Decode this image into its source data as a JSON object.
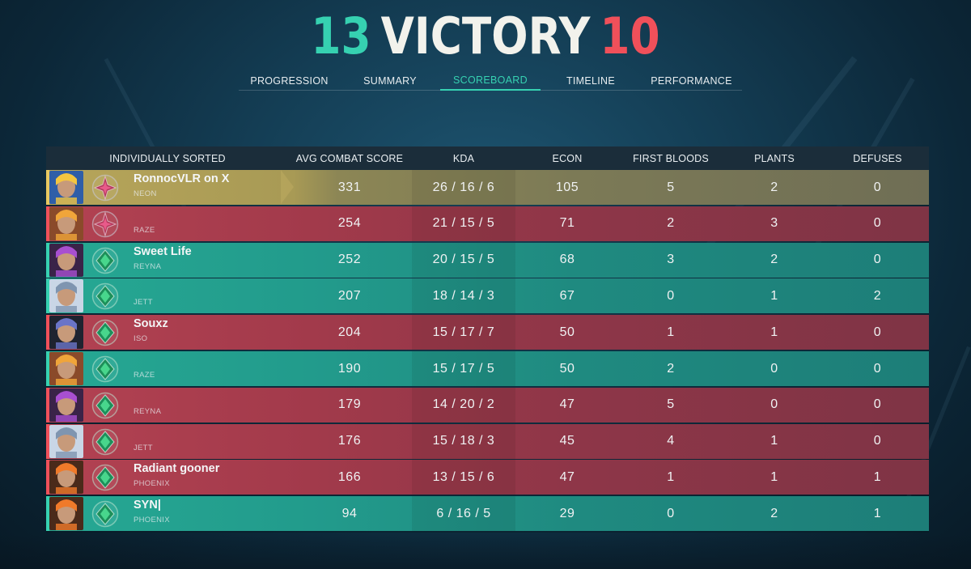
{
  "score": {
    "ally": "13",
    "result": "VICTORY",
    "enemy": "10"
  },
  "tabs": [
    {
      "label": "PROGRESSION"
    },
    {
      "label": "SUMMARY"
    },
    {
      "label": "SCOREBOARD",
      "active": true
    },
    {
      "label": "TIMELINE"
    },
    {
      "label": "PERFORMANCE"
    }
  ],
  "columns": {
    "name": "INDIVIDUALLY SORTED",
    "acs": "AVG COMBAT SCORE",
    "kda": "KDA",
    "econ": "ECON",
    "first_bloods": "FIRST BLOODS",
    "plants": "PLANTS",
    "defuses": "DEFUSES"
  },
  "colors": {
    "ally": "#36d1b1",
    "enemy": "#f0505a",
    "self_row": "#a0944e",
    "ally_row": "#229b8c",
    "enemy_row": "#9e3a4a"
  },
  "players": [
    {
      "name": "RonnocVLR on X",
      "agent": "NEON",
      "team": "self",
      "rank_icon": "ascendant-rank-icon",
      "acs": "331",
      "kda": "26 / 16 / 6",
      "econ": "105",
      "first_bloods": "5",
      "plants": "2",
      "defuses": "0"
    },
    {
      "name": "",
      "agent": "RAZE",
      "team": "enemy",
      "rank_icon": "ascendant-rank-icon",
      "acs": "254",
      "kda": "21 / 15 / 5",
      "econ": "71",
      "first_bloods": "2",
      "plants": "3",
      "defuses": "0"
    },
    {
      "name": "Sweet Life",
      "agent": "REYNA",
      "team": "ally",
      "rank_icon": "emerald-rank-icon",
      "acs": "252",
      "kda": "20 / 15 / 5",
      "econ": "68",
      "first_bloods": "3",
      "plants": "2",
      "defuses": "0"
    },
    {
      "name": "",
      "agent": "JETT",
      "team": "ally",
      "rank_icon": "emerald-rank-icon",
      "acs": "207",
      "kda": "18 / 14 / 3",
      "econ": "67",
      "first_bloods": "0",
      "plants": "1",
      "defuses": "2"
    },
    {
      "name": "Souxz",
      "agent": "ISO",
      "team": "enemy",
      "rank_icon": "emerald-rank-icon",
      "acs": "204",
      "kda": "15 / 17 / 7",
      "econ": "50",
      "first_bloods": "1",
      "plants": "1",
      "defuses": "0"
    },
    {
      "name": "",
      "agent": "RAZE",
      "team": "ally",
      "rank_icon": "emerald-rank-icon",
      "acs": "190",
      "kda": "15 / 17 / 5",
      "econ": "50",
      "first_bloods": "2",
      "plants": "0",
      "defuses": "0"
    },
    {
      "name": "",
      "agent": "REYNA",
      "team": "enemy",
      "rank_icon": "emerald-rank-icon",
      "acs": "179",
      "kda": "14 / 20 / 2",
      "econ": "47",
      "first_bloods": "5",
      "plants": "0",
      "defuses": "0"
    },
    {
      "name": "",
      "agent": "JETT",
      "team": "enemy",
      "rank_icon": "emerald-rank-icon",
      "acs": "176",
      "kda": "15 / 18 / 3",
      "econ": "45",
      "first_bloods": "4",
      "plants": "1",
      "defuses": "0"
    },
    {
      "name": "Radiant gooner",
      "agent": "PHOENIX",
      "team": "enemy",
      "rank_icon": "emerald-rank-icon",
      "acs": "166",
      "kda": "13 / 15 / 6",
      "econ": "47",
      "first_bloods": "1",
      "plants": "1",
      "defuses": "1"
    },
    {
      "name": "SYN|",
      "agent": "PHOENIX",
      "team": "ally",
      "rank_icon": "emerald-rank-icon",
      "acs": "94",
      "kda": "6 / 16 / 5",
      "econ": "29",
      "first_bloods": "0",
      "plants": "2",
      "defuses": "1"
    }
  ]
}
